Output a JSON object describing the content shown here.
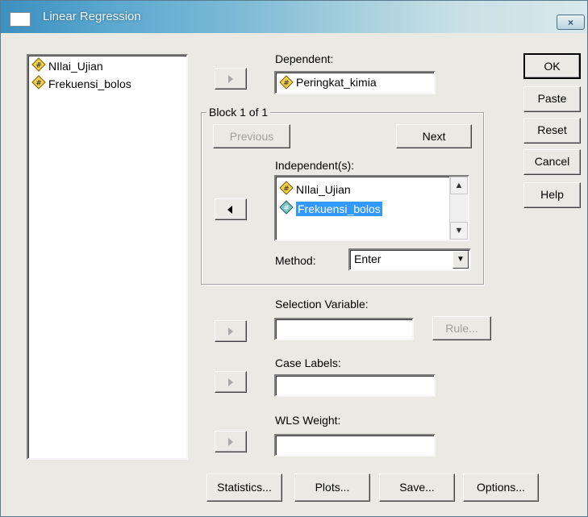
{
  "window": {
    "title": "Linear Regression",
    "close_label": "×"
  },
  "source_list": {
    "items": [
      {
        "label": "NIlai_Ujian",
        "icon": "scale-variable-icon"
      },
      {
        "label": "Frekuensi_bolos",
        "icon": "scale-variable-icon"
      }
    ]
  },
  "dependent": {
    "label": "Dependent:",
    "value": "Peringkat_kimia"
  },
  "block": {
    "title": "Block 1 of 1",
    "previous_label": "Previous",
    "next_label": "Next",
    "independents_label": "Independent(s):",
    "independents": [
      {
        "label": "NIlai_Ujian",
        "selected": false
      },
      {
        "label": "Frekuensi_bolos",
        "selected": true
      }
    ],
    "method_label": "Method:",
    "method_value": "Enter"
  },
  "selection": {
    "label": "Selection Variable:",
    "value": "",
    "rule_label": "Rule..."
  },
  "case_labels": {
    "label": "Case Labels:",
    "value": ""
  },
  "wls": {
    "label": "WLS Weight:",
    "value": ""
  },
  "side_buttons": {
    "ok": "OK",
    "paste": "Paste",
    "reset": "Reset",
    "cancel": "Cancel",
    "help": "Help"
  },
  "bottom_buttons": {
    "statistics": "Statistics...",
    "plots": "Plots...",
    "save": "Save...",
    "options": "Options..."
  },
  "colors": {
    "selection": "#3399ff",
    "dialog_bg": "#ebe9e3"
  }
}
